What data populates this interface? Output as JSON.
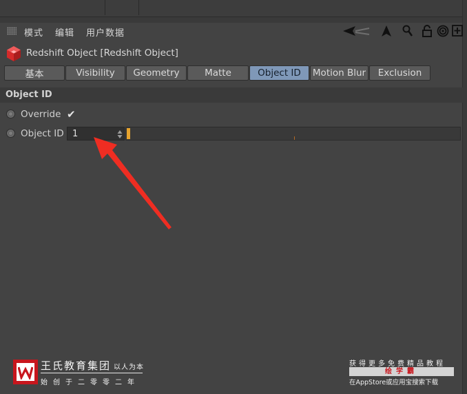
{
  "menu": {
    "items": [
      "模式",
      "编辑",
      "用户数据"
    ]
  },
  "object": {
    "title": "Redshift Object [Redshift Object]"
  },
  "tabs": [
    {
      "label": "基本",
      "active": false
    },
    {
      "label": "Visibility",
      "active": false
    },
    {
      "label": "Geometry",
      "active": false
    },
    {
      "label": "Matte",
      "active": false
    },
    {
      "label": "Object ID",
      "active": true
    },
    {
      "label": "Motion Blur",
      "active": false
    },
    {
      "label": "Exclusion",
      "active": false
    }
  ],
  "section": {
    "title": "Object ID"
  },
  "params": {
    "override": {
      "label": "Override",
      "checked": true,
      "check_glyph": "✔"
    },
    "object_id": {
      "label": "Object ID",
      "value": "1",
      "slider_fraction": 0.0
    }
  },
  "icons": {
    "menu_grip": "grip-icon",
    "redshift": "redshift-cube-icon",
    "toolbar": [
      "back-arrow-icon",
      "pointer-arrow-icon",
      "search-icon",
      "lock-icon",
      "target-icon",
      "add-icon"
    ]
  },
  "watermark": {
    "brand_name": "王氏教育集团",
    "slogan": "以人为本",
    "since": "始创于二零零二年",
    "promo_top": "获得更多免费精品教程",
    "promo_bar": "绘学霸",
    "promo_bottom": "在AppStore或应用宝搜索下载"
  },
  "colors": {
    "panel_bg": "#434343",
    "active_tab": "#7f98b8",
    "slider_accent": "#e7a32d",
    "arrow": "#ef2d22",
    "brand_red": "#c8161d"
  }
}
